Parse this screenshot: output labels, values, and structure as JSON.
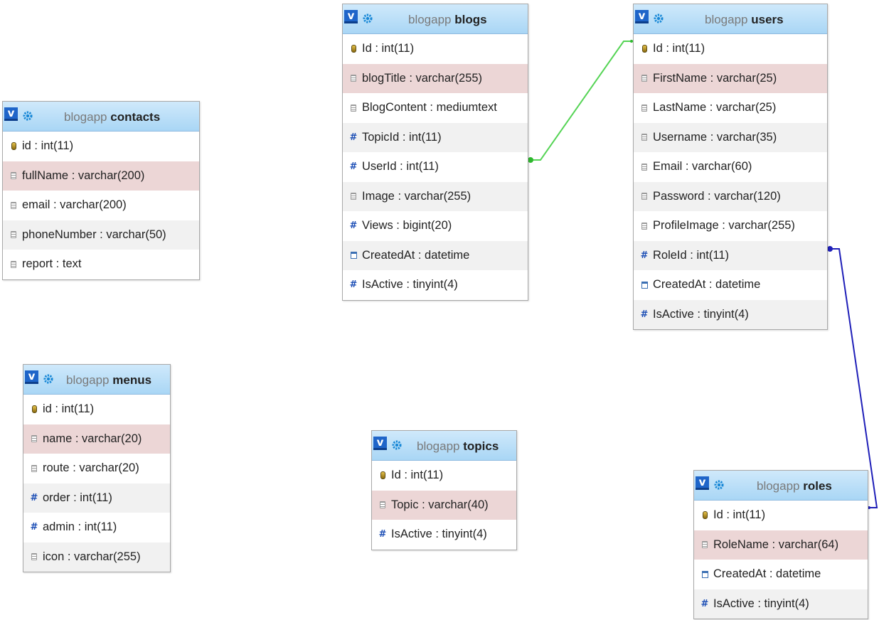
{
  "colors": {
    "header_top": "#cfe9fb",
    "header_bottom": "#a9d6f5",
    "row_alt": "#f1f1f1",
    "row_selected": "#ecd6d6",
    "relation_blogs_users": "#55d455",
    "relation_users_roles": "#1f1fb8",
    "icon_blue": "#1c4eb5"
  },
  "tables": {
    "contacts": {
      "header_button": "v",
      "db": "blogapp",
      "name": "contacts",
      "columns": [
        {
          "label": "id : int(11)",
          "icon": "key-icon"
        },
        {
          "label": "fullName : varchar(200)",
          "icon": "text-icon"
        },
        {
          "label": "email : varchar(200)",
          "icon": "text-icon"
        },
        {
          "label": "phoneNumber : varchar(50)",
          "icon": "text-icon"
        },
        {
          "label": "report : text",
          "icon": "text-icon"
        }
      ]
    },
    "blogs": {
      "header_button": "v",
      "db": "blogapp",
      "name": "blogs",
      "columns": [
        {
          "label": "Id : int(11)",
          "icon": "key-icon"
        },
        {
          "label": "blogTitle : varchar(255)",
          "icon": "text-icon"
        },
        {
          "label": "BlogContent : mediumtext",
          "icon": "text-icon"
        },
        {
          "label": "TopicId : int(11)",
          "icon": "number-icon"
        },
        {
          "label": "UserId : int(11)",
          "icon": "number-icon"
        },
        {
          "label": "Image : varchar(255)",
          "icon": "text-icon"
        },
        {
          "label": "Views : bigint(20)",
          "icon": "number-icon"
        },
        {
          "label": "CreatedAt : datetime",
          "icon": "date-icon"
        },
        {
          "label": "IsActive : tinyint(4)",
          "icon": "number-icon"
        }
      ]
    },
    "users": {
      "header_button": "v",
      "db": "blogapp",
      "name": "users",
      "columns": [
        {
          "label": "Id : int(11)",
          "icon": "key-icon"
        },
        {
          "label": "FirstName : varchar(25)",
          "icon": "text-icon"
        },
        {
          "label": "LastName : varchar(25)",
          "icon": "text-icon"
        },
        {
          "label": "Username : varchar(35)",
          "icon": "text-icon"
        },
        {
          "label": "Email : varchar(60)",
          "icon": "text-icon"
        },
        {
          "label": "Password : varchar(120)",
          "icon": "text-icon"
        },
        {
          "label": "ProfileImage : varchar(255)",
          "icon": "text-icon"
        },
        {
          "label": "RoleId : int(11)",
          "icon": "number-icon"
        },
        {
          "label": "CreatedAt : datetime",
          "icon": "date-icon"
        },
        {
          "label": "IsActive : tinyint(4)",
          "icon": "number-icon"
        }
      ]
    },
    "menus": {
      "header_button": "v",
      "db": "blogapp",
      "name": "menus",
      "columns": [
        {
          "label": "id : int(11)",
          "icon": "key-icon"
        },
        {
          "label": "name : varchar(20)",
          "icon": "text-icon"
        },
        {
          "label": "route : varchar(20)",
          "icon": "text-icon"
        },
        {
          "label": "order : int(11)",
          "icon": "number-icon"
        },
        {
          "label": "admin : int(11)",
          "icon": "number-icon"
        },
        {
          "label": "icon : varchar(255)",
          "icon": "text-icon"
        }
      ]
    },
    "topics": {
      "header_button": "v",
      "db": "blogapp",
      "name": "topics",
      "columns": [
        {
          "label": "Id : int(11)",
          "icon": "key-icon"
        },
        {
          "label": "Topic : varchar(40)",
          "icon": "text-icon"
        },
        {
          "label": "IsActive : tinyint(4)",
          "icon": "number-icon"
        }
      ]
    },
    "roles": {
      "header_button": "v",
      "db": "blogapp",
      "name": "roles",
      "columns": [
        {
          "label": "Id : int(11)",
          "icon": "key-icon"
        },
        {
          "label": "RoleName : varchar(64)",
          "icon": "text-icon"
        },
        {
          "label": "CreatedAt : datetime",
          "icon": "date-icon"
        },
        {
          "label": "IsActive : tinyint(4)",
          "icon": "number-icon"
        }
      ]
    }
  }
}
